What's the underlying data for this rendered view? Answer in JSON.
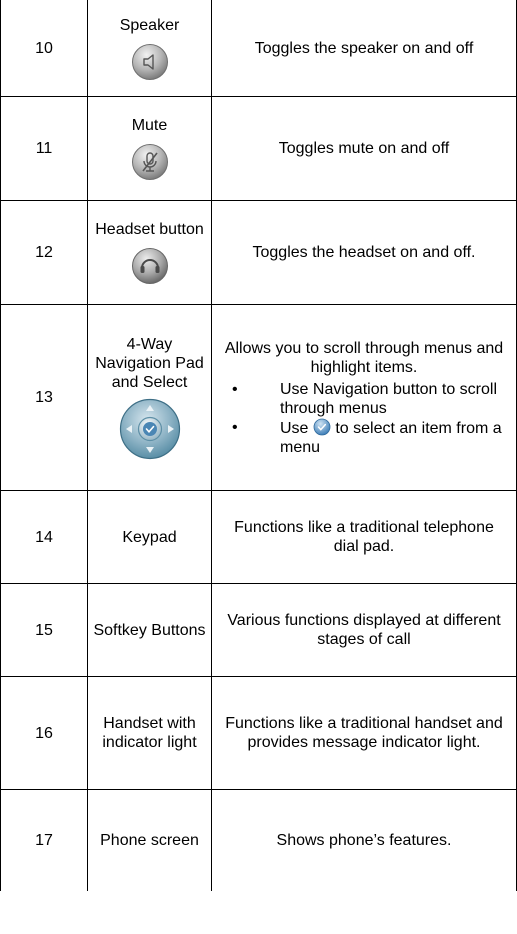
{
  "rows": [
    {
      "number": "10",
      "feature": "Speaker",
      "description": "Toggles the speaker on and off",
      "icon": "speaker-icon"
    },
    {
      "number": "11",
      "feature": "Mute",
      "description": "Toggles mute on and off",
      "icon": "mute-icon"
    },
    {
      "number": "12",
      "feature": "Headset button",
      "description": "Toggles the headset on and off.",
      "icon": "headset-icon"
    },
    {
      "number": "13",
      "feature": "4-Way Navigation Pad and Select",
      "description": "Allows you to scroll through menus and highlight items.",
      "icon": "navigation-pad-icon",
      "bullets": [
        {
          "text": "Use Navigation button to scroll through menus"
        },
        {
          "pre": "Use",
          "icon": "select-icon",
          "post": "to select an item from a menu"
        }
      ]
    },
    {
      "number": "14",
      "feature": "Keypad",
      "description": "Functions like a traditional telephone dial pad."
    },
    {
      "number": "15",
      "feature": "Softkey Buttons",
      "description": "Various functions displayed at different stages of call"
    },
    {
      "number": "16",
      "feature": "Handset with indicator light",
      "description": "Functions like a traditional handset and provides message indicator light."
    },
    {
      "number": "17",
      "feature": "Phone screen",
      "description": "Shows phone’s features."
    }
  ],
  "colors": {
    "border": "#000000",
    "icon_grey": "#9a9a9a",
    "nav_blue": "#4f87a0",
    "select_blue": "#3f7fb8"
  }
}
